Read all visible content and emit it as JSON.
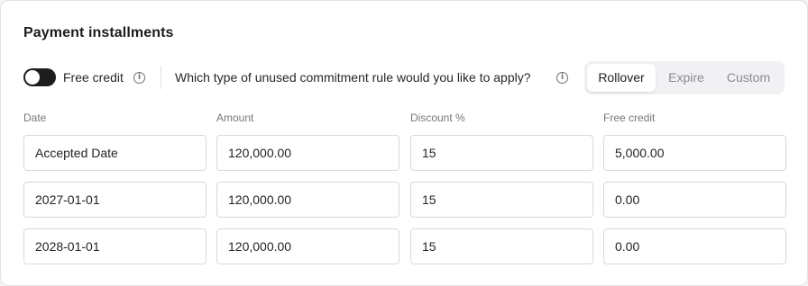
{
  "section": {
    "title": "Payment installments"
  },
  "controls": {
    "free_credit_label": "Free credit",
    "free_credit_enabled": false,
    "info_glyph": "i",
    "question": "Which type of unused commitment rule would you like to apply?",
    "rule_options": [
      "Rollover",
      "Expire",
      "Custom"
    ],
    "selected_rule": "Rollover"
  },
  "table": {
    "headers": [
      "Date",
      "Amount",
      "Discount %",
      "Free credit"
    ],
    "rows": [
      [
        "Accepted Date",
        "120,000.00",
        "15",
        "5,000.00"
      ],
      [
        "2027-01-01",
        "120,000.00",
        "15",
        "0.00"
      ],
      [
        "2028-01-01",
        "120,000.00",
        "15",
        "0.00"
      ]
    ]
  },
  "colors": {
    "toggle_off": "#1d1d20",
    "segment_bg": "#f1f1f3",
    "text_muted": "#8b8b90"
  }
}
